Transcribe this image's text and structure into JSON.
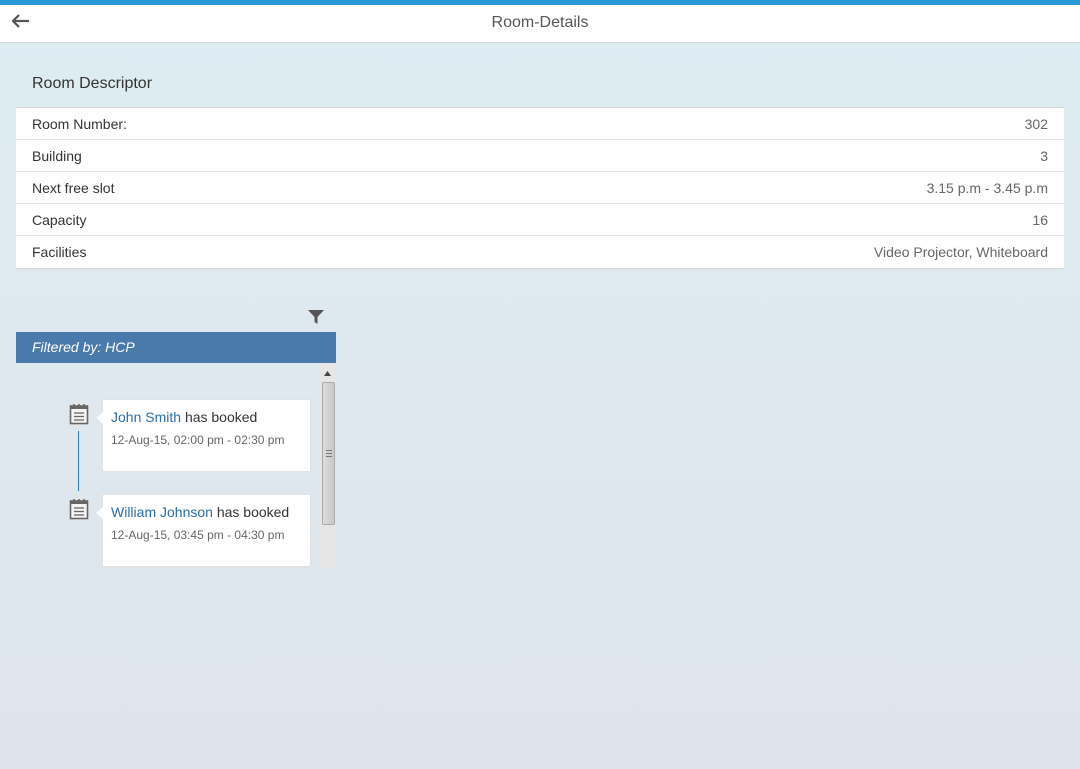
{
  "header": {
    "title": "Room-Details",
    "back_icon": "arrow-left-icon"
  },
  "descriptor": {
    "title": "Room Descriptor",
    "rows": [
      {
        "label": "Room Number:",
        "value": "302"
      },
      {
        "label": "Building",
        "value": "3"
      },
      {
        "label": "Next free slot",
        "value": "3.15 p.m - 3.45 p.m"
      },
      {
        "label": "Capacity",
        "value": "16"
      },
      {
        "label": "Facilities",
        "value": "Video Projector, Whiteboard"
      }
    ]
  },
  "filter": {
    "icon": "filter-icon",
    "label": "Filtered by: HCP"
  },
  "timeline": {
    "items": [
      {
        "person": "John Smith",
        "action": "has booked",
        "time": "12-Aug-15, 02:00 pm - 02:30 pm",
        "icon": "calendar-icon"
      },
      {
        "person": "William Johnson",
        "action": "has booked",
        "time": "12-Aug-15, 03:45 pm - 04:30 pm",
        "icon": "calendar-icon"
      }
    ]
  },
  "colors": {
    "accent": "#2a9ad6",
    "filter_bar": "#4a7aab",
    "link": "#2a6ea6"
  }
}
